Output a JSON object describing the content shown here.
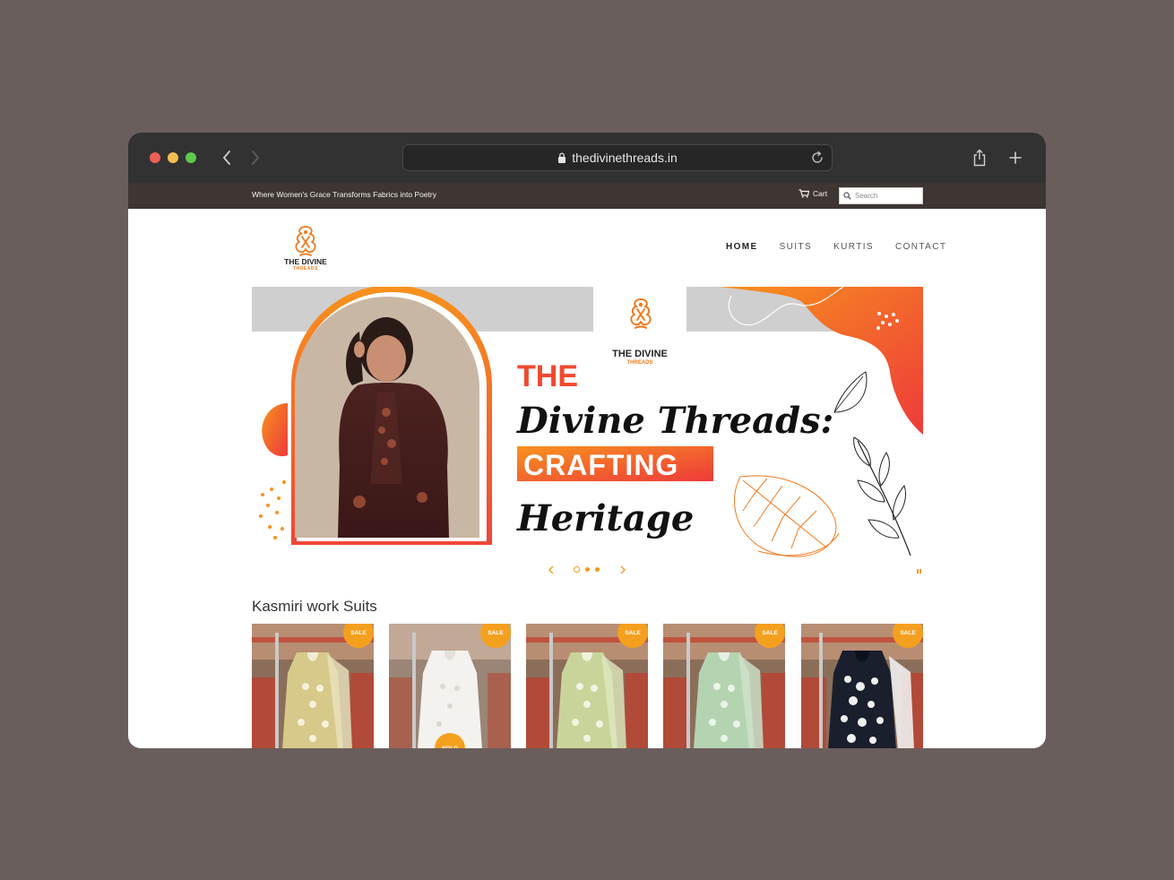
{
  "browser": {
    "url": "thedivinethreads.in",
    "colors": {
      "close": "#ee5f57",
      "minimize": "#f5bf4f",
      "zoom": "#5dc84c"
    }
  },
  "topbar": {
    "tagline": "Where Women's Grace Transforms Fabrics into Poetry",
    "cart_label": "Cart",
    "search_placeholder": "Search"
  },
  "brand": {
    "name_line1": "THE DIVINE",
    "name_line2": "THREADS",
    "accent_color": "#f07a1e"
  },
  "nav": {
    "items": [
      {
        "label": "HOME",
        "active": true
      },
      {
        "label": "SUITS",
        "active": false
      },
      {
        "label": "KURTIS",
        "active": false
      },
      {
        "label": "CONTACT",
        "active": false
      }
    ]
  },
  "hero": {
    "line1": "THE",
    "line2": "Divine Threads:",
    "line3": "CRAFTING",
    "line4": "Heritage",
    "slide_count": 3,
    "active_slide": 1
  },
  "section": {
    "title": "Kasmiri work Suits"
  },
  "products": [
    {
      "badge": "SALE",
      "color": "yellow-white"
    },
    {
      "badge": "SALE",
      "extra_badge": "SOLD",
      "color": "white"
    },
    {
      "badge": "SALE",
      "color": "lime-white"
    },
    {
      "badge": "SALE",
      "color": "mint-white"
    },
    {
      "badge": "SALE",
      "color": "black-white"
    }
  ]
}
